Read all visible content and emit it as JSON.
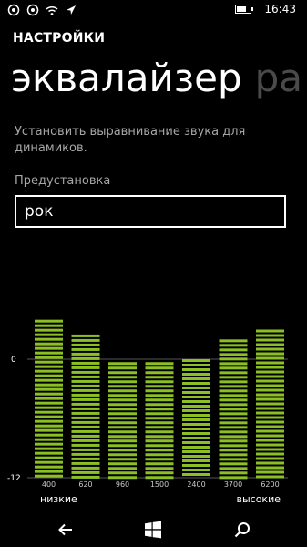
{
  "status": {
    "time": "16:43",
    "icons": [
      "notification-icon",
      "notification-icon",
      "wifi-icon",
      "location-icon"
    ],
    "battery_level": 0.7
  },
  "app_title": "НАСТРОЙКИ",
  "pivot": {
    "active": "эквалайзер",
    "next": "ра"
  },
  "description": "Установить выравнивание звука для динамиков.",
  "preset": {
    "label": "Предустановка",
    "value": "рок"
  },
  "equalizer": {
    "y_max_label": "0",
    "y_min_label": "-12",
    "low_label": "низкие",
    "high_label": "высокие",
    "bands": [
      {
        "freq": "400",
        "level": 4
      },
      {
        "freq": "620",
        "level": 2.5
      },
      {
        "freq": "960",
        "level": -0.3
      },
      {
        "freq": "1500",
        "level": -0.3
      },
      {
        "freq": "2400",
        "level": 0
      },
      {
        "freq": "3700",
        "level": 2
      },
      {
        "freq": "6200",
        "level": 3
      }
    ],
    "bar_color": "#8cbf26"
  },
  "navbar": {
    "icons": [
      "back-icon",
      "windows-start-icon",
      "search-icon"
    ]
  }
}
